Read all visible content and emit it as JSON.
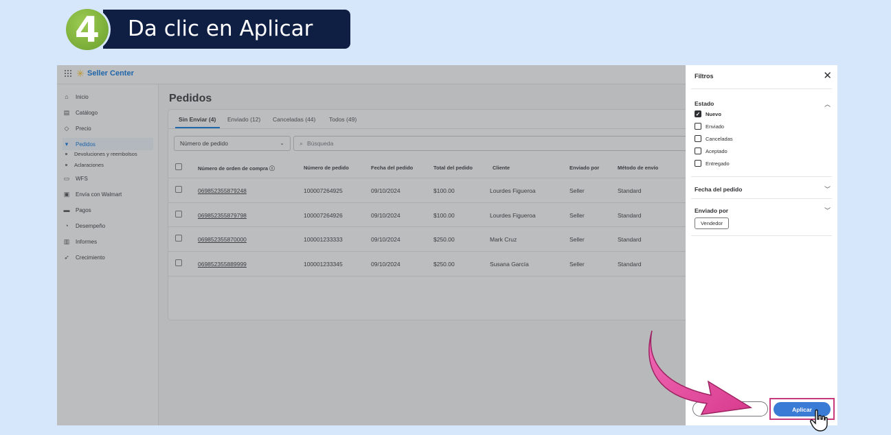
{
  "step": {
    "number": "4",
    "title": "Da clic en Aplicar"
  },
  "app": {
    "brand": "Seller Center"
  },
  "sidebar": {
    "items": [
      {
        "label": "Inicio",
        "icon": "home-icon"
      },
      {
        "label": "Catálogo",
        "icon": "catalog-icon"
      },
      {
        "label": "Precio",
        "icon": "tag-icon"
      },
      {
        "label": "Pedidos",
        "icon": "cart-icon",
        "active": true
      },
      {
        "label": "Devoluciones y reembolsos",
        "sub": true
      },
      {
        "label": "Aclaraciones",
        "sub": true
      },
      {
        "label": "WFS",
        "icon": "box-icon"
      },
      {
        "label": "Envía con Walmart",
        "icon": "truck-icon"
      },
      {
        "label": "Pagos",
        "icon": "card-icon"
      },
      {
        "label": "Desempeño",
        "icon": "gauge-icon"
      },
      {
        "label": "Informes",
        "icon": "chart-icon"
      },
      {
        "label": "Crecimiento",
        "icon": "rocket-icon"
      }
    ]
  },
  "main": {
    "title": "Pedidos",
    "tabs": [
      "Sin Enviar (4)",
      "Enviado (12)",
      "Canceladas (44)",
      "Todos (49)"
    ],
    "filter_select": "Número de pedido",
    "search_placeholder": "Búsqueda",
    "columns": [
      "Número de orden de compra",
      "Número de pedido",
      "Fecha del pedido",
      "Total del pedido",
      "Cliente",
      "Enviado por",
      "Método de envío"
    ],
    "rows": [
      [
        "069852355879248",
        "100007264925",
        "09/10/2024",
        "$100.00",
        "Lourdes Figueroa",
        "Seller",
        "Standard"
      ],
      [
        "069852355879798",
        "100007264926",
        "09/10/2024",
        "$100.00",
        "Lourdes Figueroa",
        "Seller",
        "Standard"
      ],
      [
        "069852355870000",
        "100001233333",
        "09/10/2024",
        "$250.00",
        "Mark Cruz",
        "Seller",
        "Standard"
      ],
      [
        "069852355889999",
        "100001233345",
        "09/10/2024",
        "$250.00",
        "Susana García",
        "Seller",
        "Standard"
      ]
    ]
  },
  "filters": {
    "title": "Filtros",
    "estado": {
      "title": "Estado",
      "options": [
        {
          "label": "Nuevo",
          "checked": true
        },
        {
          "label": "Enviado",
          "checked": false
        },
        {
          "label": "Canceladas",
          "checked": false
        },
        {
          "label": "Aceptado",
          "checked": false
        },
        {
          "label": "Entregado",
          "checked": false
        }
      ]
    },
    "fecha_title": "Fecha del pedido",
    "enviado_title": "Enviado por",
    "enviado_chip": "Vendedor",
    "apply_label": "Aplicar"
  },
  "colors": {
    "banner": "#0f1f44",
    "step_circle": "#7fb23a",
    "accent": "#0071dc",
    "apply": "#3a7bd5",
    "arrow": "#e0529c"
  }
}
